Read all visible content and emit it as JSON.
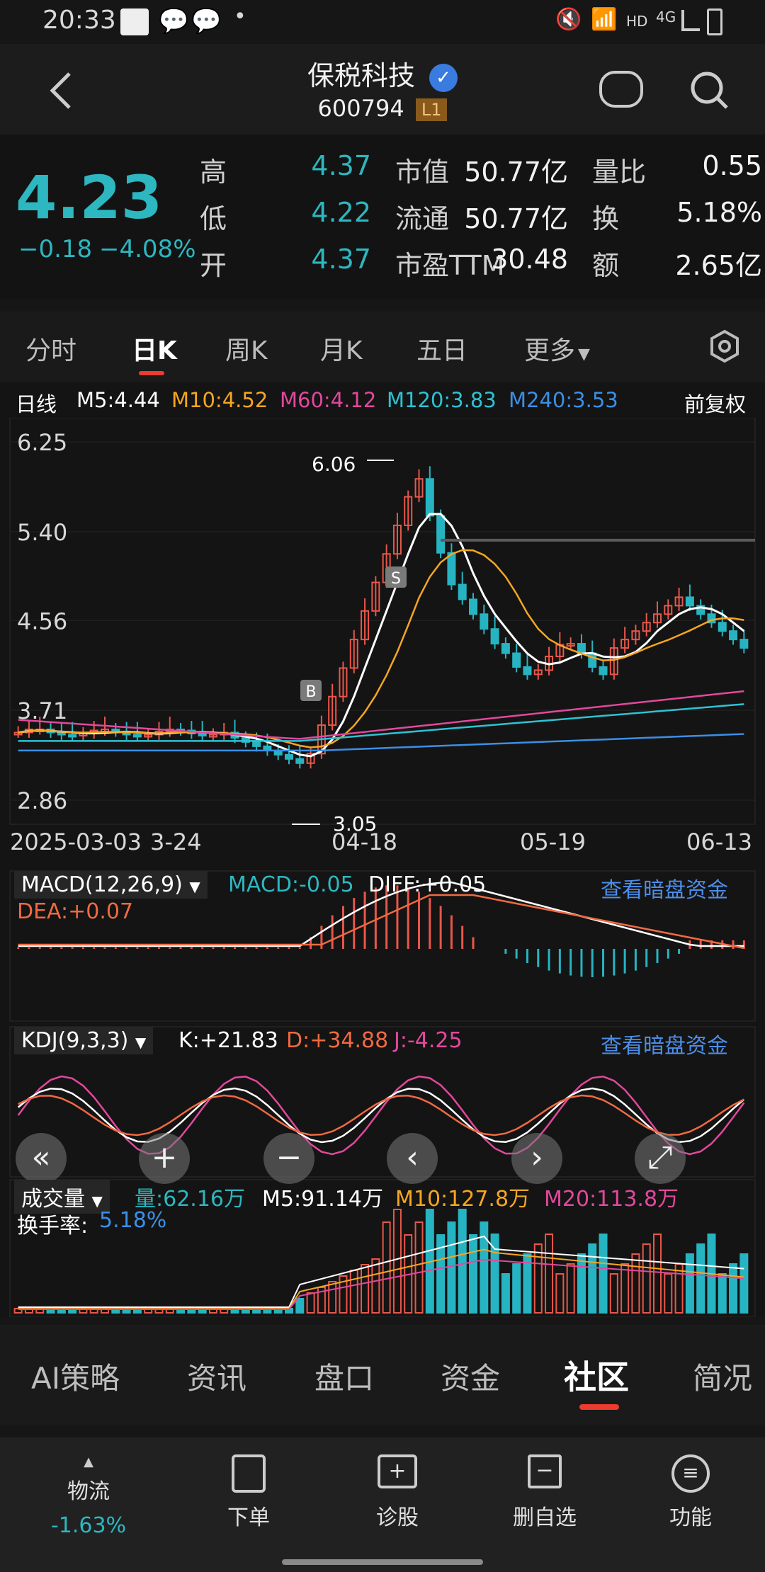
{
  "status_bar": {
    "time": "20:33",
    "network": "HD",
    "signal": "4G"
  },
  "header": {
    "name": "保税科技",
    "code": "600794",
    "level_badge": "L1"
  },
  "quote": {
    "price": "4.23",
    "change": "−0.18",
    "change_pct": "−4.08%",
    "rows": [
      {
        "k1": "高",
        "v1": "4.37",
        "k2": "市值",
        "v2": "50.77亿",
        "k3": "量比",
        "v3": "0.55"
      },
      {
        "k1": "低",
        "v1": "4.22",
        "k2": "流通",
        "v2": "50.77亿",
        "k3": "换",
        "v3": "5.18%"
      },
      {
        "k1": "开",
        "v1": "4.37",
        "k2": "市盈TTM",
        "v2": "30.48",
        "k3": "额",
        "v3": "2.65亿"
      }
    ]
  },
  "tabs": {
    "items": [
      "分时",
      "日K",
      "周K",
      "月K",
      "五日",
      "更多"
    ],
    "active": "日K"
  },
  "ma_legend": {
    "period": "日线",
    "m5": "M5:4.44",
    "m10": "M10:4.52",
    "m60": "M60:4.12",
    "m120": "M120:3.83",
    "m240": "M240:3.53",
    "adjust": "前复权"
  },
  "kline": {
    "y_labels": [
      "6.25",
      "5.40",
      "4.56",
      "3.71",
      "2.86"
    ],
    "x_labels": [
      "2025-03-03",
      "3-24",
      "04-18",
      "05-19",
      "06-13"
    ],
    "high_mark": "6.06",
    "low_mark": "3.05",
    "buy_mark": "B",
    "sell_mark": "S"
  },
  "macd": {
    "label": "MACD(12,26,9)",
    "macd": "MACD:-0.05",
    "diff": "DIFF:+0.05",
    "dea": "DEA:+0.07",
    "link": "查看暗盘资金"
  },
  "kdj": {
    "label": "KDJ(9,3,3)",
    "k": "K:+21.83",
    "d": "D:+34.88",
    "j": "J:-4.25",
    "link": "查看暗盘资金"
  },
  "volume": {
    "label": "成交量",
    "vol": "量:62.16万",
    "m5": "M5:91.14万",
    "m10": "M10:127.8万",
    "m20": "M20:113.8万",
    "turnover_label": "换手率:",
    "turnover": "5.18%"
  },
  "bottom_tabs": {
    "items": [
      "AI策略",
      "资讯",
      "盘口",
      "资金",
      "社区",
      "简况"
    ],
    "active": "社区"
  },
  "footer": {
    "sector": "物流",
    "sector_change": "-1.63%",
    "items": [
      "下单",
      "诊股",
      "删自选",
      "功能"
    ]
  },
  "chart_data": {
    "type": "candlestick",
    "ylim": [
      2.86,
      6.25
    ],
    "high": 6.06,
    "low": 3.05,
    "close_last": 4.23,
    "ma": {
      "M5": 4.44,
      "M10": 4.52,
      "M60": 4.12,
      "M120": 3.83,
      "M240": 3.53
    },
    "colors": {
      "up": "#e8574a",
      "down": "#27b4c2",
      "m5": "#ffffff",
      "m10": "#f5a623",
      "m60": "#e2489d",
      "m120": "#2dc3d4",
      "m240": "#3b8fe6"
    }
  }
}
